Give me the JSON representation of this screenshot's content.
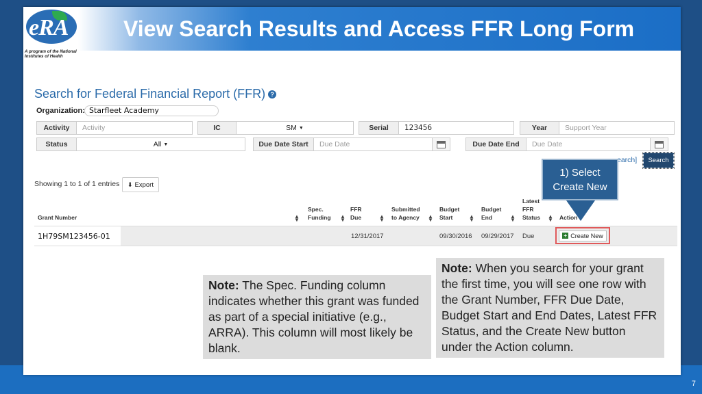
{
  "slide_title": "View Search Results and Access FFR Long Form",
  "logo": {
    "text": "eRA",
    "caption": "A program of the National Institutes of Health"
  },
  "page_title": "Search for Federal Financial Report (FFR)",
  "help_glyph": "?",
  "organization": {
    "label": "Organization:",
    "value": "Starfleet Academy"
  },
  "fields": {
    "activity": {
      "label": "Activity",
      "placeholder": "Activity"
    },
    "ic": {
      "label": "IC",
      "value": "SM"
    },
    "serial": {
      "label": "Serial",
      "value": "123456"
    },
    "year": {
      "label": "Year",
      "placeholder": "Support Year"
    },
    "status": {
      "label": "Status",
      "value": "All"
    },
    "due_start": {
      "label": "Due Date Start",
      "placeholder": "Due Date"
    },
    "due_end": {
      "label": "Due Date End",
      "placeholder": "Due Date"
    }
  },
  "search_link": "earch]",
  "search_button": "Search",
  "callout": "1) Select Create New",
  "showing_text": "Showing 1 to 1 of 1 entries",
  "export_label": "Export",
  "table": {
    "headers": {
      "grant_number": "Grant Number",
      "spec_funding": "Spec. Funding",
      "ffr_due": "FFR Due",
      "submitted": "Submitted to Agency",
      "budget_start": "Budget Start",
      "budget_end": "Budget End",
      "latest_status": "Latest FFR Status",
      "action": "Action"
    },
    "row": {
      "grant_number": "1H79SM123456-01",
      "ffr_due": "12/31/2017",
      "budget_start": "09/30/2016",
      "budget_end": "09/29/2017",
      "latest_status": "Due",
      "action": "Create New"
    }
  },
  "notes": {
    "left": {
      "label": "Note:",
      "text": "The Spec. Funding column indicates whether this grant was funded as part of a special initiative (e.g., ARRA).  This column will most likely be blank."
    },
    "right": {
      "label": "Note:",
      "text": "When you search for your grant the first time, you will see one row with the Grant Number, FFR Due Date, Budget Start and End Dates, Latest FFR Status, and the Create New button under the Action column."
    }
  },
  "slide_number": "7",
  "colors": {
    "title_bar": "#1b6ec6",
    "callout": "#2a5f93",
    "search_button": "#22476e",
    "highlight_border": "#e0595a",
    "note_bg": "#dcdcdc"
  }
}
